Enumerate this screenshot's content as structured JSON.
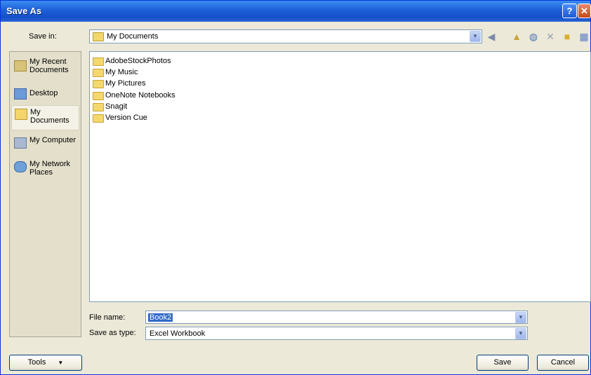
{
  "window": {
    "title": "Save As",
    "help_icon": "?",
    "close_icon": "✕"
  },
  "save_in": {
    "label": "Save in:",
    "value": "My Documents"
  },
  "toolbar_icons": [
    "back-icon",
    "up-folder-icon",
    "search-web-icon",
    "delete-icon",
    "new-folder-icon",
    "views-icon"
  ],
  "places": [
    {
      "label": "My Recent Documents",
      "icon": "recent-icon",
      "selected": false
    },
    {
      "label": "Desktop",
      "icon": "desktop-icon",
      "selected": false
    },
    {
      "label": "My Documents",
      "icon": "documents-icon",
      "selected": true
    },
    {
      "label": "My Computer",
      "icon": "computer-icon",
      "selected": false
    },
    {
      "label": "My Network Places",
      "icon": "network-icon",
      "selected": false
    }
  ],
  "files": [
    {
      "name": "AdobeStockPhotos"
    },
    {
      "name": "My Music"
    },
    {
      "name": "My Pictures"
    },
    {
      "name": "OneNote Notebooks"
    },
    {
      "name": "Snagit"
    },
    {
      "name": "Version Cue"
    }
  ],
  "file_name": {
    "label": "File name:",
    "value": "Book2"
  },
  "save_as_type": {
    "label": "Save as type:",
    "value": "Excel Workbook"
  },
  "buttons": {
    "tools": "Tools",
    "save": "Save",
    "cancel": "Cancel"
  }
}
